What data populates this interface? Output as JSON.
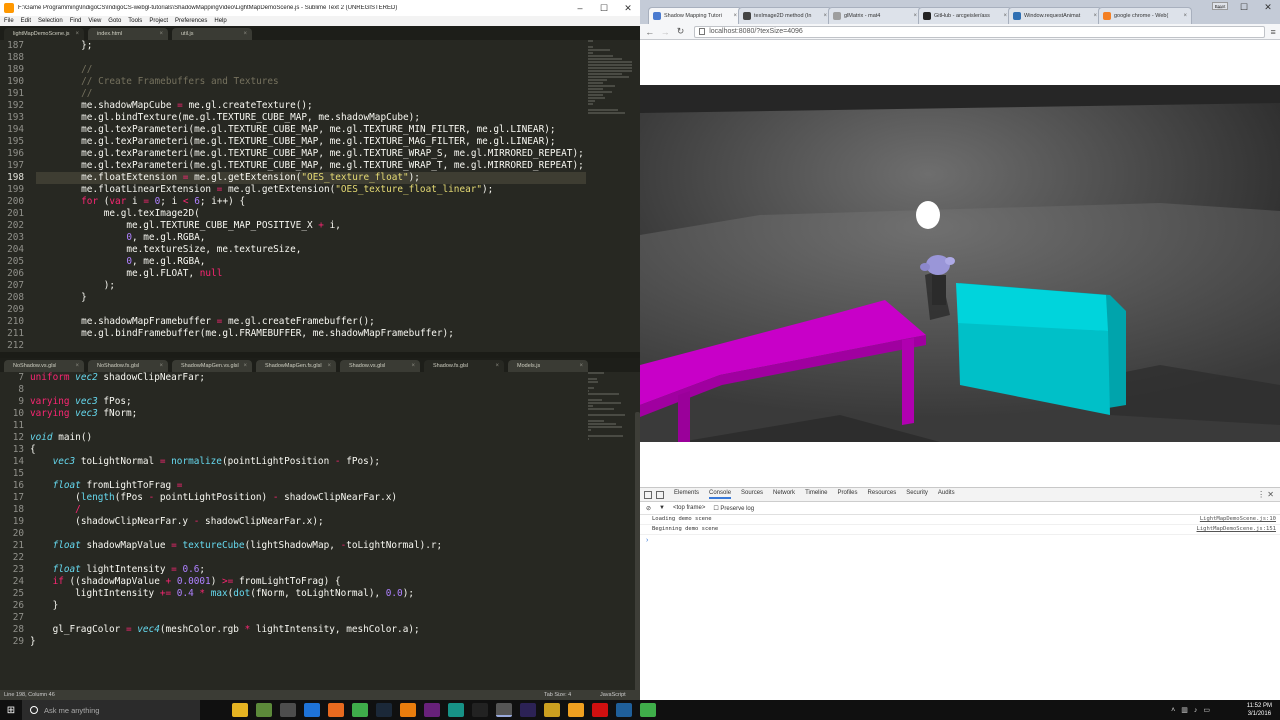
{
  "sublime": {
    "title": "F:\\Game Programming\\IndigoCS\\IndigoCS-webgl-tutorials\\ShadowMappingVideo\\LightMapDemoScene.js - Sublime Text 2 (UNREGISTERED)",
    "menu": [
      "File",
      "Edit",
      "Selection",
      "Find",
      "View",
      "Goto",
      "Tools",
      "Project",
      "Preferences",
      "Help"
    ],
    "top_tabs": [
      "lightMapDemoScene.js",
      "index.html",
      "util.js"
    ],
    "bottom_tabs": [
      "NoShadow.vs.glsl",
      "NoShadow.fs.glsl",
      "ShadowMapGen.vs.glsl",
      "ShadowMapGen.fs.glsl",
      "Shadow.vs.glsl",
      "Shadow.fs.glsl",
      "Models.js"
    ],
    "top_code": [
      {
        "n": "187",
        "t": "        };"
      },
      {
        "n": "188",
        "t": ""
      },
      {
        "n": "189",
        "t": "        //"
      },
      {
        "n": "190",
        "t": "        // Create Framebuffers and Textures"
      },
      {
        "n": "191",
        "t": "        //"
      },
      {
        "n": "192",
        "t": "        me.shadowMapCube = me.gl.createTexture();"
      },
      {
        "n": "193",
        "t": "        me.gl.bindTexture(me.gl.TEXTURE_CUBE_MAP, me.shadowMapCube);"
      },
      {
        "n": "194",
        "t": "        me.gl.texParameteri(me.gl.TEXTURE_CUBE_MAP, me.gl.TEXTURE_MIN_FILTER, me.gl.LINEAR);"
      },
      {
        "n": "195",
        "t": "        me.gl.texParameteri(me.gl.TEXTURE_CUBE_MAP, me.gl.TEXTURE_MAG_FILTER, me.gl.LINEAR);"
      },
      {
        "n": "196",
        "t": "        me.gl.texParameteri(me.gl.TEXTURE_CUBE_MAP, me.gl.TEXTURE_WRAP_S, me.gl.MIRRORED_REPEAT);"
      },
      {
        "n": "197",
        "t": "        me.gl.texParameteri(me.gl.TEXTURE_CUBE_MAP, me.gl.TEXTURE_WRAP_T, me.gl.MIRRORED_REPEAT);"
      },
      {
        "n": "198",
        "t": "        me.floatExtension = me.gl.getExtension(\"OES_texture_float\");"
      },
      {
        "n": "199",
        "t": "        me.floatLinearExtension = me.gl.getExtension(\"OES_texture_float_linear\");"
      },
      {
        "n": "200",
        "t": "        for (var i = 0; i < 6; i++) {"
      },
      {
        "n": "201",
        "t": "            me.gl.texImage2D("
      },
      {
        "n": "202",
        "t": "                me.gl.TEXTURE_CUBE_MAP_POSITIVE_X + i,"
      },
      {
        "n": "203",
        "t": "                0, me.gl.RGBA,"
      },
      {
        "n": "204",
        "t": "                me.textureSize, me.textureSize,"
      },
      {
        "n": "205",
        "t": "                0, me.gl.RGBA,"
      },
      {
        "n": "206",
        "t": "                me.gl.FLOAT, null"
      },
      {
        "n": "207",
        "t": "            );"
      },
      {
        "n": "208",
        "t": "        }"
      },
      {
        "n": "209",
        "t": ""
      },
      {
        "n": "210",
        "t": "        me.shadowMapFramebuffer = me.gl.createFramebuffer();"
      },
      {
        "n": "211",
        "t": "        me.gl.bindFramebuffer(me.gl.FRAMEBUFFER, me.shadowMapFramebuffer);"
      },
      {
        "n": "212",
        "t": ""
      }
    ],
    "bottom_code": [
      {
        "n": "7",
        "t": "uniform vec2 shadowClipNearFar;"
      },
      {
        "n": "8",
        "t": ""
      },
      {
        "n": "9",
        "t": "varying vec3 fPos;"
      },
      {
        "n": "10",
        "t": "varying vec3 fNorm;"
      },
      {
        "n": "11",
        "t": ""
      },
      {
        "n": "12",
        "t": "void main()"
      },
      {
        "n": "13",
        "t": "{"
      },
      {
        "n": "14",
        "t": "    vec3 toLightNormal = normalize(pointLightPosition - fPos);"
      },
      {
        "n": "15",
        "t": ""
      },
      {
        "n": "16",
        "t": "    float fromLightToFrag ="
      },
      {
        "n": "17",
        "t": "        (length(fPos - pointLightPosition) - shadowClipNearFar.x)"
      },
      {
        "n": "18",
        "t": "        /"
      },
      {
        "n": "19",
        "t": "        (shadowClipNearFar.y - shadowClipNearFar.x);"
      },
      {
        "n": "20",
        "t": ""
      },
      {
        "n": "21",
        "t": "    float shadowMapValue = textureCube(lightShadowMap, -toLightNormal).r;"
      },
      {
        "n": "22",
        "t": ""
      },
      {
        "n": "23",
        "t": "    float lightIntensity = 0.6;"
      },
      {
        "n": "24",
        "t": "    if ((shadowMapValue + 0.0001) >= fromLightToFrag) {"
      },
      {
        "n": "25",
        "t": "        lightIntensity += 0.4 * max(dot(fNorm, toLightNormal), 0.0);"
      },
      {
        "n": "26",
        "t": "    }"
      },
      {
        "n": "27",
        "t": ""
      },
      {
        "n": "28",
        "t": "    gl_FragColor = vec4(meshColor.rgb * lightIntensity, meshColor.a);"
      },
      {
        "n": "29",
        "t": "}"
      }
    ],
    "status_left": "Line 198, Column 46",
    "status_tab": "Tab Size: 4",
    "status_syntax": "JavaScript"
  },
  "chrome": {
    "tabs": [
      {
        "label": "Shadow Mapping Tutori",
        "color": "#4a7bd0"
      },
      {
        "label": "texImage2D method (In",
        "color": "#444444"
      },
      {
        "label": "glMatrix - mat4",
        "color": "#9e9e9e"
      },
      {
        "label": "GitHub - arcgeisler/ass",
        "color": "#222222"
      },
      {
        "label": "Window.requestAnimat",
        "color": "#2f6fb3"
      },
      {
        "label": "google chrome - Web(",
        "color": "#f48024"
      }
    ],
    "user_button": "Brent",
    "url": "localhost:8080/?texSize=4096",
    "devtools": {
      "tabs": [
        "Elements",
        "Console",
        "Sources",
        "Network",
        "Timeline",
        "Profiles",
        "Resources",
        "Security",
        "Audits"
      ],
      "active_tab": "Console",
      "filter_context": "<top frame>",
      "preserve_log": "Preserve log",
      "messages": [
        {
          "text": "Loading demo scene",
          "source": "LightMapDemoScene.js:10"
        },
        {
          "text": "Beginning demo scene",
          "source": "LightMapDemoScene.js:151"
        }
      ],
      "prompt": "›"
    }
  },
  "taskbar": {
    "search_placeholder": "Ask me anything",
    "time": "11:52 PM",
    "date": "3/1/2016",
    "apps": [
      {
        "name": "task-view-icon",
        "color": "#101010"
      },
      {
        "name": "file-explorer-icon",
        "color": "#e6b422"
      },
      {
        "name": "minecraft-icon",
        "color": "#5c8a3a"
      },
      {
        "name": "sublime-text-icon",
        "color": "#4d4d4d"
      },
      {
        "name": "edge-icon",
        "color": "#1e73d8"
      },
      {
        "name": "firefox-icon",
        "color": "#e86a1f"
      },
      {
        "name": "chrome-icon",
        "color": "#3fae4a"
      },
      {
        "name": "steam-icon",
        "color": "#1b2838"
      },
      {
        "name": "blender-icon",
        "color": "#e87d0d"
      },
      {
        "name": "visual-studio-icon",
        "color": "#68217a"
      },
      {
        "name": "gitkraken-icon",
        "color": "#179287"
      },
      {
        "name": "unity-icon",
        "color": "#222222"
      },
      {
        "name": "sublime-active-icon",
        "color": "#555555"
      },
      {
        "name": "eclipse-icon",
        "color": "#2c2255"
      },
      {
        "name": "chrome-canary-icon",
        "color": "#cca020"
      },
      {
        "name": "audacity-icon",
        "color": "#f0a020"
      },
      {
        "name": "heart-app-icon",
        "color": "#d01010"
      },
      {
        "name": "photoshop-icon",
        "color": "#1f5f9a"
      },
      {
        "name": "chrome-dev-icon",
        "color": "#3fae4a"
      }
    ]
  },
  "colors": {
    "magenta_table": "#c000c0",
    "cyan_couch": "#00c8d0"
  }
}
